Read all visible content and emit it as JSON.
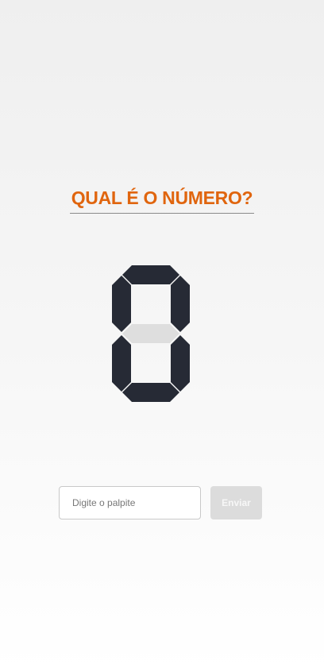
{
  "title": "QUAL É O NÚMERO?",
  "display": {
    "digit": "0",
    "segments_on": [
      "a",
      "b",
      "c",
      "d",
      "e",
      "f"
    ],
    "segments_off": [
      "g"
    ],
    "color_on": "#262a35",
    "color_off": "#dedede"
  },
  "form": {
    "input_placeholder": "Digite o palpite",
    "input_value": "",
    "submit_label": "Enviar",
    "submit_enabled": false
  },
  "colors": {
    "accent": "#e0650e",
    "button_disabled_bg": "#dcdcdc"
  }
}
